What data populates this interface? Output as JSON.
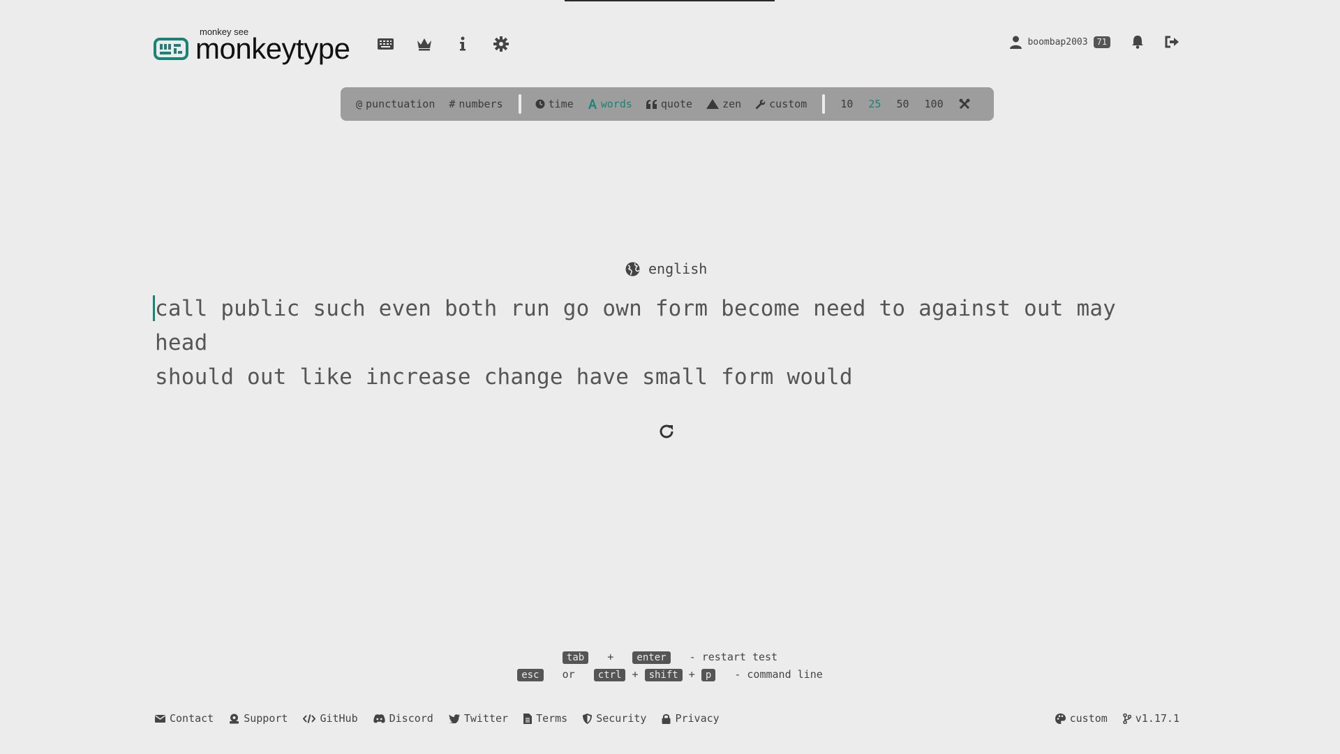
{
  "header": {
    "logo_sub": "monkey see",
    "logo_title": "monkeytype",
    "username": "boombap2003",
    "level": "71"
  },
  "config": {
    "punctuation": "punctuation",
    "numbers": "numbers",
    "time": "time",
    "words": "words",
    "quote": "quote",
    "zen": "zen",
    "custom": "custom",
    "counts": [
      "10",
      "25",
      "50",
      "100"
    ],
    "active_mode": "words",
    "active_count": "25",
    "accent_color": "#1a8377"
  },
  "test": {
    "language": "english",
    "words_line1": "call public such even both run go own form become need to against out may head",
    "words_line2": "should out like increase change have small form would"
  },
  "hints": {
    "tab": "tab",
    "plus": "+",
    "enter": "enter",
    "restart_text": "- restart test",
    "esc": "esc",
    "or": "or",
    "ctrl": "ctrl",
    "shift": "shift",
    "p": "p",
    "command_text": "- command line"
  },
  "footer": {
    "links": [
      "Contact",
      "Support",
      "GitHub",
      "Discord",
      "Twitter",
      "Terms",
      "Security",
      "Privacy"
    ],
    "theme": "custom",
    "version": "v1.17.1"
  }
}
